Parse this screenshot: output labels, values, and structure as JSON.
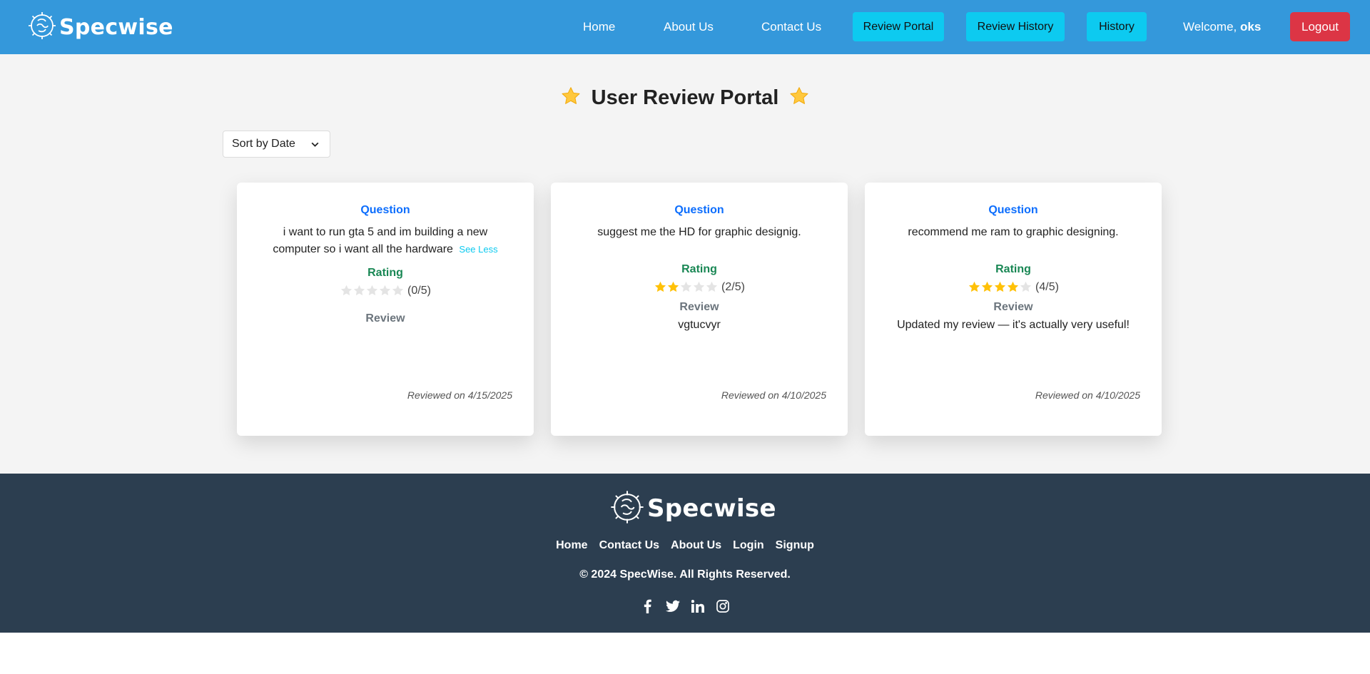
{
  "brand": {
    "name": "Specwise",
    "icon": "gear-brain-icon"
  },
  "nav": {
    "links": [
      "Home",
      "About Us",
      "Contact Us"
    ],
    "buttons": [
      "Review Portal",
      "Review History",
      "History"
    ],
    "welcome_prefix": "Welcome,",
    "username": "oks",
    "logout": "Logout"
  },
  "colors": {
    "navbar": "#3498db",
    "nav_button": "#0dcaf0",
    "logout": "#dc3545",
    "question_label": "#0d6efd",
    "rating_label": "#198754",
    "star_filled": "#ffc107",
    "star_empty": "#e4e4e4",
    "footer": "#2c3e50"
  },
  "page": {
    "title": "User Review Portal",
    "title_icon": "star-icon",
    "sort": {
      "selected": "Sort by Date",
      "icon": "chevron-down-icon"
    }
  },
  "labels": {
    "question": "Question",
    "rating": "Rating",
    "review": "Review"
  },
  "reviews": [
    {
      "question": "i want to run gta 5 and im building a new computer so i want all the hardware",
      "toggle": "See Less",
      "rating": 0,
      "rating_text": "(0/5)",
      "review": "",
      "date": "Reviewed on 4/15/2025"
    },
    {
      "question": "suggest me the HD for graphic designig.",
      "rating": 2,
      "rating_text": "(2/5)",
      "review": "vgtucvyr",
      "date": "Reviewed on 4/10/2025"
    },
    {
      "question": "recommend me ram to graphic designing.",
      "rating": 4,
      "rating_text": "(4/5)",
      "review": "Updated my review — it's actually very useful!",
      "date": "Reviewed on 4/10/2025"
    }
  ],
  "footer": {
    "links": [
      "Home",
      "Contact Us",
      "About Us",
      "Login",
      "Signup"
    ],
    "copyright": "© 2024 SpecWise. All Rights Reserved.",
    "socials": [
      "facebook-icon",
      "twitter-icon",
      "linkedin-icon",
      "instagram-icon"
    ]
  }
}
